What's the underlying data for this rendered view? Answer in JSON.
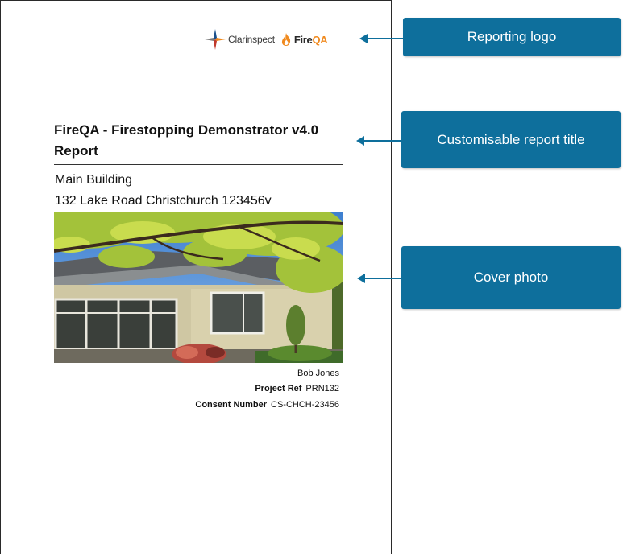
{
  "logos": {
    "clarinspect": "Clarinspect",
    "fireqa_fire": "Fire",
    "fireqa_qa": "QA"
  },
  "report": {
    "title": "FireQA - Firestopping Demonstrator v4.0 Report",
    "building": "Main Building",
    "address": "132 Lake Road Christchurch 123456v",
    "inspector": "Bob Jones",
    "project_ref_label": "Project Ref",
    "project_ref": "PRN132",
    "consent_label": "Consent Number",
    "consent_number": "CS-CHCH-23456"
  },
  "callouts": {
    "logo": "Reporting logo",
    "title": "Customisable report title",
    "photo": "Cover photo"
  },
  "colors": {
    "callout_bg": "#0e6f9c",
    "fireqa_accent": "#f08a1f"
  }
}
